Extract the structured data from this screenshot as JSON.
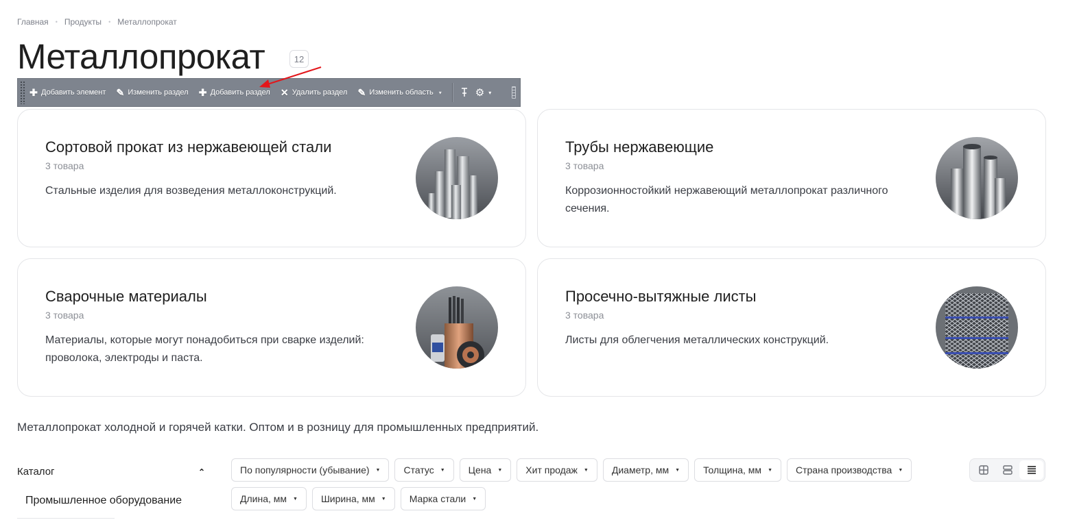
{
  "breadcrumb": {
    "items": [
      "Главная",
      "Продукты",
      "Металлопрокат"
    ],
    "separator": "•"
  },
  "page": {
    "title": "Металлопрокат",
    "count": "12"
  },
  "admin_toolbar": {
    "buttons": [
      {
        "label": "Добавить элемент",
        "icon": "plus-icon"
      },
      {
        "label": "Изменить раздел",
        "icon": "pencil-icon"
      },
      {
        "label": "Добавить раздел",
        "icon": "plus-icon"
      },
      {
        "label": "Удалить раздел",
        "icon": "close-icon"
      },
      {
        "label": "Изменить область",
        "icon": "pencil-icon"
      }
    ],
    "icons": [
      "pin-icon",
      "gear-icon"
    ]
  },
  "sections": [
    {
      "title": "Сортовой прокат из нержавеющей стали",
      "count": "3 товара",
      "description": "Стальные изделия для возведения металлоконструкций."
    },
    {
      "title": "Трубы нержавеющие",
      "count": "3 товара",
      "description": "Коррозионностойкий нержавеющий металлопрокат различного сечения."
    },
    {
      "title": "Сварочные материалы",
      "count": "3 товара",
      "description": "Материалы, которые могут понадобиться при сварке изделий: проволока, электроды и паста."
    },
    {
      "title": "Просечно-вытяжные листы",
      "count": "3 товара",
      "description": "Листы для облегчения металлических конструкций."
    }
  ],
  "seo_text": "Металлопрокат холодной и горячей катки. Оптом и в розницу для промышленных предприятий.",
  "catalog": {
    "title": "Каталог",
    "items": [
      "Промышленное оборудование"
    ]
  },
  "filters": [
    "По популярности (убывание)",
    "Статус",
    "Цена",
    "Хит продаж",
    "Диаметр, мм",
    "Толщина, мм",
    "Страна производства",
    "Длина, мм",
    "Ширина, мм",
    "Марка стали"
  ],
  "view_modes": [
    {
      "icon": "grid-view-icon",
      "active": false
    },
    {
      "icon": "tile-view-icon",
      "active": false
    },
    {
      "icon": "list-view-icon",
      "active": true
    }
  ],
  "colors": {
    "toolbar_bg": "#7e848e",
    "annotation_arrow": "#e3161b",
    "card_border": "#e4e5e8"
  }
}
